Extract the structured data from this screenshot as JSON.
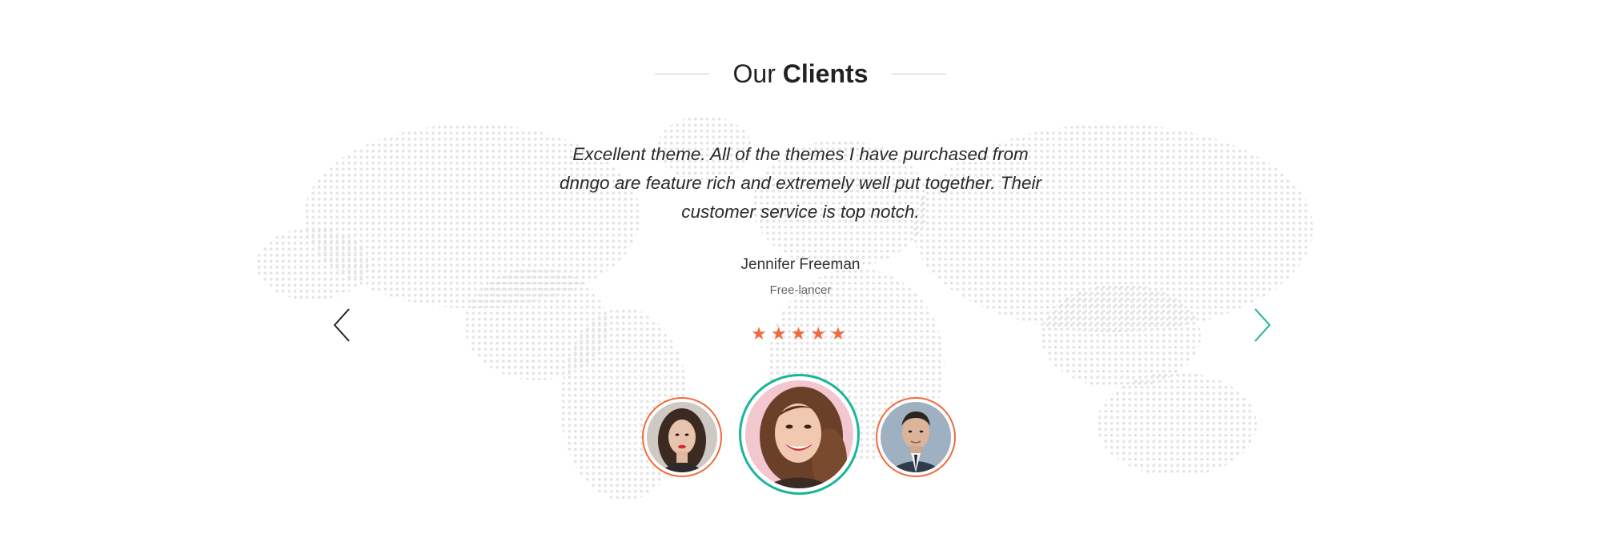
{
  "section": {
    "title_light": "Our",
    "title_bold": "Clients"
  },
  "testimonial": {
    "quote": "Excellent theme. All of the themes I have purchased from dnngo are feature rich and extremely well put together. Their customer service is top notch.",
    "name": "Jennifer Freeman",
    "role": "Free-lancer",
    "rating": 5
  },
  "stars": {
    "s1": "★",
    "s2": "★",
    "s3": "★",
    "s4": "★",
    "s5": "★"
  },
  "colors": {
    "accent_orange": "#f26a3b",
    "accent_teal": "#1bb59a",
    "map_dot": "#e4e4e4"
  },
  "icons": {
    "prev": "chevron-left-icon",
    "next": "chevron-right-icon",
    "star": "star-icon"
  }
}
